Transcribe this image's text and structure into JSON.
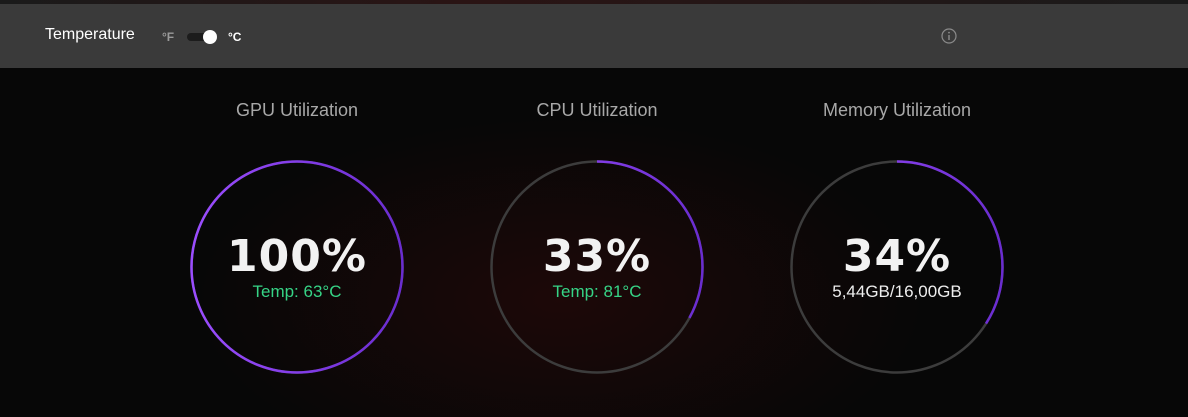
{
  "header": {
    "title": "Temperature",
    "unit_f": "°F",
    "unit_c": "°C",
    "selected_unit": "°C",
    "info_icon": "info-circle-icon"
  },
  "metrics": [
    {
      "title": "GPU Utilization",
      "value_text": "100%",
      "percent": 100,
      "sub": "Temp: 63°C",
      "sub_color": "green"
    },
    {
      "title": "CPU Utilization",
      "value_text": "33%",
      "percent": 33,
      "sub": "Temp: 81°C",
      "sub_color": "green"
    },
    {
      "title": "Memory Utilization",
      "value_text": "34%",
      "percent": 34,
      "sub": "5,44GB/16,00GB",
      "sub_color": "white"
    }
  ],
  "colors": {
    "accent_start": "#9b4dff",
    "accent_end": "#6a2cd0",
    "ring_track": "#3c3c3c",
    "temp_green": "#36d486",
    "header_bg": "#3a3a3a"
  }
}
